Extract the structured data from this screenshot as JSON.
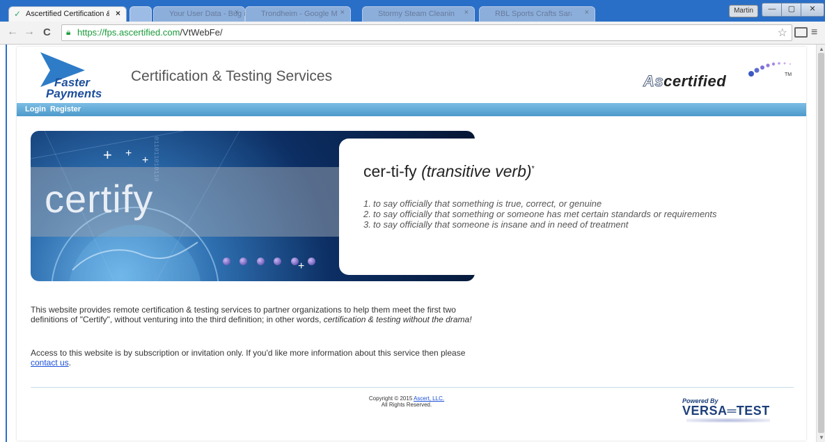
{
  "browser": {
    "active_tab": {
      "title": "Ascertified Certification &",
      "close": "×"
    },
    "background_tabs": [
      {
        "title": "Your User Data - Bug info"
      },
      {
        "title": "Trondheim - Google Maps"
      },
      {
        "title": "Stormy Steam Cleaning"
      },
      {
        "title": "RBL Sports Crafts Sarasota"
      }
    ],
    "user": "Martin",
    "window_controls": {
      "minimize": "—",
      "maximize": "▢",
      "close": "✕"
    },
    "nav": {
      "back": "←",
      "forward": "→",
      "reload": "C"
    },
    "url": {
      "scheme_host": "https://fps.ascertified.com",
      "path": "/VtWebFe/"
    },
    "icons": {
      "lock": "lock-icon",
      "star": "star-icon",
      "cast": "cast-icon",
      "menu": "menu-icon"
    }
  },
  "site": {
    "logo_left": {
      "line1": "Faster",
      "line2": "Payments"
    },
    "title": "Certification & Testing Services",
    "logo_right": {
      "prefix": "As",
      "suffix": "certified",
      "tm": "TM"
    },
    "nav": {
      "login": "Login",
      "register": "Register"
    },
    "banner": {
      "word": "certify",
      "digits": "011011010110"
    },
    "definition": {
      "word": "cer-ti-fy",
      "pos": "(transitive verb)",
      "mark": "*",
      "items": [
        {
          "num": "1.",
          "text": "to say officially that something is true, correct, or genuine"
        },
        {
          "num": "2.",
          "text": "to say officially that something or someone has met certain standards or requirements"
        },
        {
          "num": "3.",
          "text": "to say officially that someone is insane and in need of treatment"
        }
      ]
    },
    "intro": {
      "text": "This website provides remote certification & testing services to partner organizations to help them meet the first two definitions of \"Certify\", without venturing into the third definition; in other words, ",
      "emphasis": "certification & testing without the drama!"
    },
    "access": {
      "text": "Access to this website is by subscription or invitation only. If you'd like more information about this service then please ",
      "link": "contact us",
      "end": "."
    },
    "footer": {
      "copyright_prefix": "Copyright © 2015 ",
      "copyright_link": "Ascert, LLC.",
      "rights": "All Rights Reserved.",
      "powered_by": "Powered By",
      "versatest": "VERSA═TEST"
    }
  },
  "colors": {
    "browser_frame": "#2a6fc7",
    "nav_bar": "#5aa5d3",
    "link": "#1a4fd8",
    "brand_blue": "#1d4f9c"
  }
}
